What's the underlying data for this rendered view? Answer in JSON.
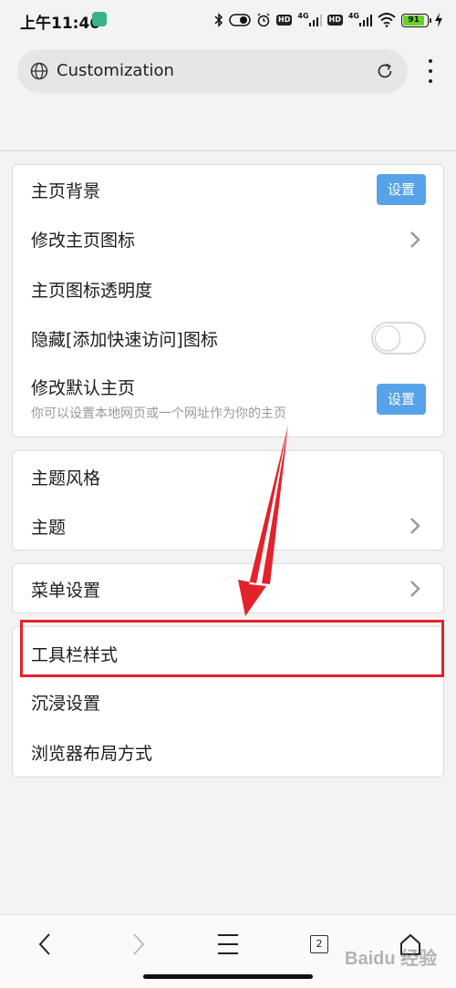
{
  "status_bar": {
    "time": "上午11:46",
    "network_tag_1": "4G",
    "network_tag_2": "4G",
    "hd_label": "HD",
    "battery_level": "91"
  },
  "address_bar": {
    "url_text": "Customization"
  },
  "sections": {
    "homepage": {
      "background_label": "主页背景",
      "background_button": "设置",
      "change_icon_label": "修改主页图标",
      "icon_opacity_label": "主页图标透明度",
      "hide_quick_access_label": "隐藏[添加快速访问]图标",
      "hide_quick_access_enabled": false,
      "default_home_label": "修改默认主页",
      "default_home_sub": "你可以设置本地网页或一个网址作为你的主页",
      "default_home_button": "设置"
    },
    "theme": {
      "style_label": "主题风格",
      "theme_label": "主题"
    },
    "menu": {
      "menu_settings_label": "菜单设置"
    },
    "toolbar": {
      "toolbar_style_label": "工具栏样式",
      "immersive_label": "沉浸设置",
      "layout_label": "浏览器布局方式"
    }
  },
  "bottom_nav": {
    "tab_count": "2"
  },
  "watermark": "Baidu 经验",
  "colors": {
    "accent_button": "#57a3ea",
    "annotation_red": "#e3222a",
    "battery_green": "#6ad02a"
  }
}
